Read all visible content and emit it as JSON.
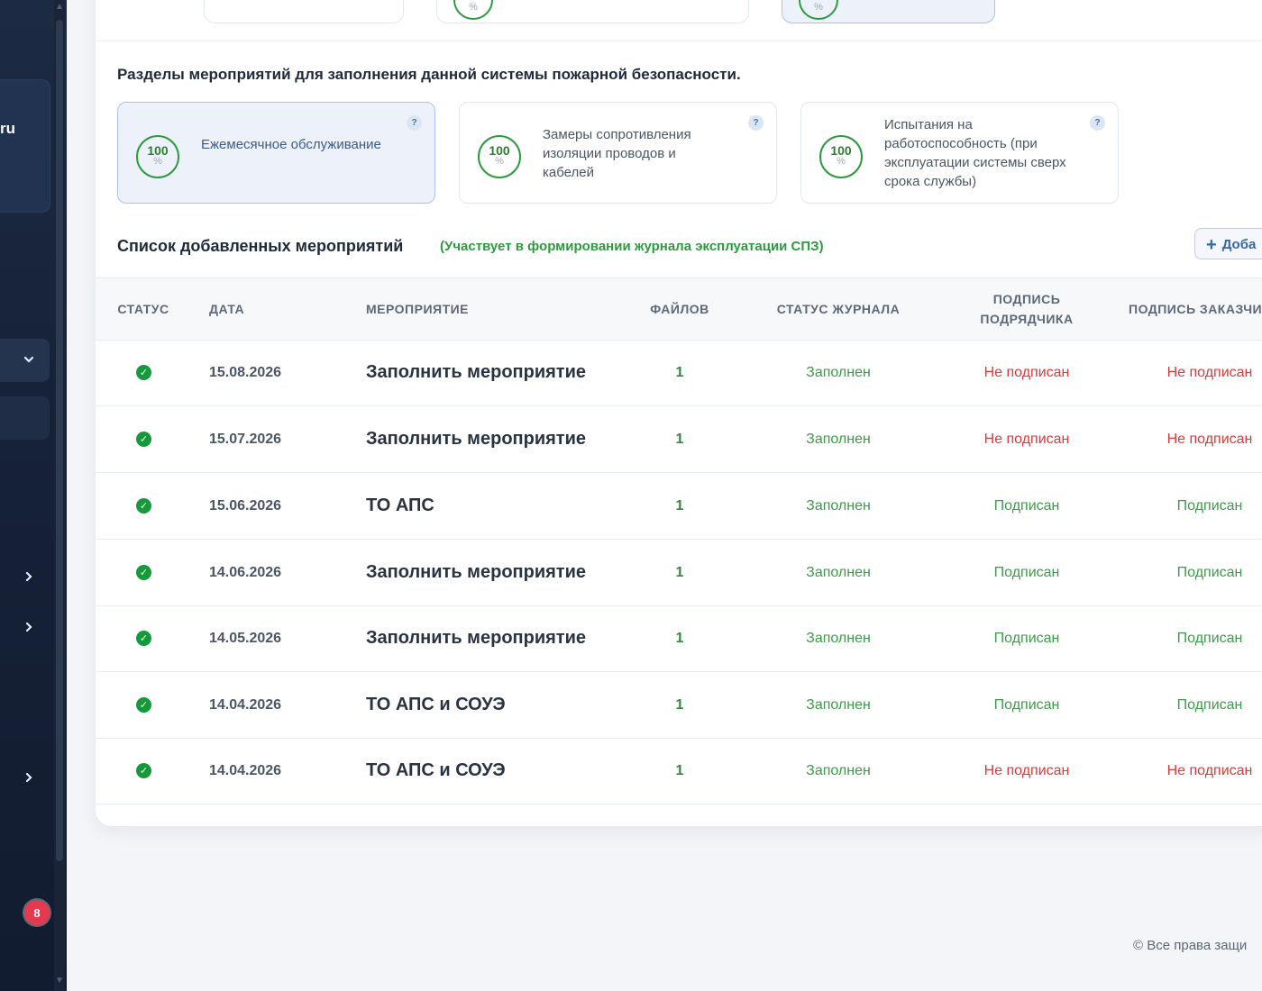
{
  "sidebar": {
    "card_text": "ru",
    "badge_count": "8",
    "chevrons": [
      "chevron-down",
      "chevron-right",
      "chevron-right",
      "chevron-right"
    ]
  },
  "sections": {
    "title": "Разделы мероприятий для заполнения данной системы пожарной безопасности.",
    "cards": [
      {
        "percent": "100",
        "symbol": "%",
        "label": "Ежемесячное обслуживание",
        "help": "?",
        "active": true
      },
      {
        "percent": "100",
        "symbol": "%",
        "label": "Замеры сопротивления изоляции проводов и кабелей",
        "help": "?",
        "active": false
      },
      {
        "percent": "100",
        "symbol": "%",
        "label": "Испытания на работоспособность (при эксплуатации системы сверх срока службы)",
        "help": "?",
        "active": false
      }
    ]
  },
  "list": {
    "title": "Список добавленных мероприятий",
    "note": "(Участвует в формировании журнала эксплуатации СПЗ)",
    "add_button": "Доба"
  },
  "table": {
    "headers": {
      "status": "СТАТУС",
      "date": "ДАТА",
      "event": "МЕРОПРИЯТИЕ",
      "files": "ФАЙЛОВ",
      "journal": "СТАТУС ЖУРНАЛА",
      "contractor_1": "ПОДПИСЬ",
      "contractor_2": "ПОДРЯДЧИКА",
      "customer": "ПОДПИСЬ ЗАКАЗЧИ"
    },
    "rows": [
      {
        "date": "15.08.2026",
        "event": "Заполнить мероприятие",
        "files": "1",
        "journal": "Заполнен",
        "contractor": "Не подписан",
        "customer": "Не подписан"
      },
      {
        "date": "15.07.2026",
        "event": "Заполнить мероприятие",
        "files": "1",
        "journal": "Заполнен",
        "contractor": "Не подписан",
        "customer": "Не подписан"
      },
      {
        "date": "15.06.2026",
        "event": "ТО АПС",
        "files": "1",
        "journal": "Заполнен",
        "contractor": "Подписан",
        "customer": "Подписан"
      },
      {
        "date": "14.06.2026",
        "event": "Заполнить мероприятие",
        "files": "1",
        "journal": "Заполнен",
        "contractor": "Подписан",
        "customer": "Подписан"
      },
      {
        "date": "14.05.2026",
        "event": "Заполнить мероприятие",
        "files": "1",
        "journal": "Заполнен",
        "contractor": "Подписан",
        "customer": "Подписан"
      },
      {
        "date": "14.04.2026",
        "event": "ТО АПС и СОУЭ",
        "files": "1",
        "journal": "Заполнен",
        "contractor": "Подписан",
        "customer": "Подписан"
      },
      {
        "date": "14.04.2026",
        "event": "ТО АПС и СОУЭ",
        "files": "1",
        "journal": "Заполнен",
        "contractor": "Не подписан",
        "customer": "Не подписан"
      }
    ]
  },
  "footer": {
    "copyright": "© Все права защи"
  },
  "colors": {
    "accent_green": "#2e9a3f",
    "danger_red": "#d93a3a",
    "sidebar_bg": "#162238",
    "primary_blue": "#3566a8"
  }
}
